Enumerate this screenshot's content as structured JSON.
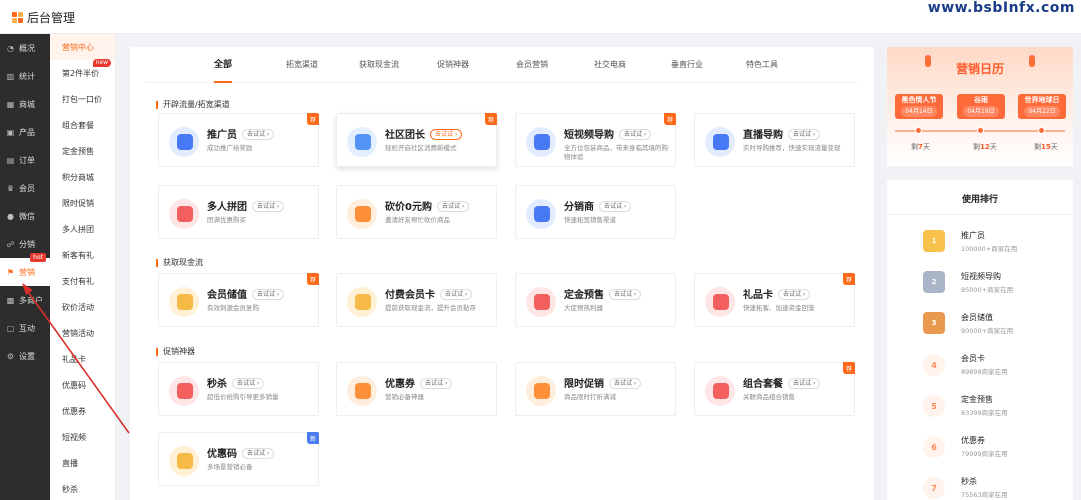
{
  "header": {
    "title": "后台管理",
    "watermark": "www.bsbInfx.com"
  },
  "nav_primary": [
    {
      "label": "概况",
      "icon": "gauge-icon"
    },
    {
      "label": "统计",
      "icon": "chart-icon"
    },
    {
      "label": "商城",
      "icon": "store-icon"
    },
    {
      "label": "产品",
      "icon": "grid-icon"
    },
    {
      "label": "订单",
      "icon": "order-icon"
    },
    {
      "label": "会员",
      "icon": "crown-icon"
    },
    {
      "label": "微信",
      "icon": "wechat-icon"
    },
    {
      "label": "分销",
      "icon": "share-icon"
    },
    {
      "label": "营销",
      "icon": "flag-icon",
      "badge": "hot",
      "active": true
    },
    {
      "label": "多商户",
      "icon": "shop-icon"
    },
    {
      "label": "互动",
      "icon": "chat-icon"
    },
    {
      "label": "设置",
      "icon": "gear-icon"
    }
  ],
  "nav_secondary": [
    {
      "label": "营销中心",
      "active": true
    },
    {
      "label": "第2件半价",
      "badge": "new"
    },
    {
      "label": "打包一口价"
    },
    {
      "label": "组合套餐"
    },
    {
      "label": "定金预售"
    },
    {
      "label": "积分商城"
    },
    {
      "label": "限时促销"
    },
    {
      "label": "多人拼团"
    },
    {
      "label": "新客有礼"
    },
    {
      "label": "支付有礼"
    },
    {
      "label": "砍价活动"
    },
    {
      "label": "营销活动"
    },
    {
      "label": "礼品卡"
    },
    {
      "label": "优惠码"
    },
    {
      "label": "优惠券"
    },
    {
      "label": "短视频"
    },
    {
      "label": "直播"
    },
    {
      "label": "秒杀"
    }
  ],
  "tabs": [
    "全部",
    "拓宽渠道",
    "获取现金流",
    "促销神器",
    "会员营销",
    "社交电商",
    "垂直行业",
    "特色工具"
  ],
  "try_label": "去试试",
  "sections": [
    {
      "title": "开辟流量/拓宽渠道"
    },
    {
      "title": "获取现金流"
    },
    {
      "title": "促销神器"
    }
  ],
  "cards": [
    {
      "title": "推广员",
      "desc": "成功推广给奖励",
      "rec": "荐",
      "icon": "megaphone-icon",
      "color": "blue"
    },
    {
      "title": "社区团长",
      "desc": "轻松开启社区消费新模式",
      "rec": "荐",
      "icon": "leader-icon",
      "color": "cyan"
    },
    {
      "title": "短视频导购",
      "desc": "全方位包装商品，带来身临其境的购物体验",
      "rec": "荐",
      "icon": "video-icon",
      "color": "blue"
    },
    {
      "title": "直播导购",
      "desc": "实时导购推荐，快速实现流量变现",
      "rec": "",
      "icon": "live-icon",
      "color": "blue"
    },
    {
      "title": "多人拼团",
      "desc": "团满优惠购买",
      "rec": "",
      "icon": "group-icon",
      "color": "red"
    },
    {
      "title": "砍价0元购",
      "desc": "邀请好友帮忙砍价商品",
      "rec": "",
      "icon": "tag-icon",
      "color": "orange"
    },
    {
      "title": "分销商",
      "desc": "快速拓宽销售渠道",
      "rec": "",
      "icon": "distributor-icon",
      "color": "blue"
    },
    {
      "title": "会员储值",
      "desc": "有效刺激会员复购",
      "rec": "荐",
      "icon": "coin-icon",
      "color": "yellow"
    },
    {
      "title": "付费会员卡",
      "desc": "提前获取现金流，提升会员黏存",
      "rec": "",
      "icon": "vip-icon",
      "color": "yellow"
    },
    {
      "title": "定金预售",
      "desc": "大促预热利器",
      "rec": "",
      "icon": "deposit-icon",
      "color": "red"
    },
    {
      "title": "礼品卡",
      "desc": "快速拓客、加速资金回笼",
      "rec": "荐",
      "icon": "gift-icon",
      "color": "red"
    },
    {
      "title": "秒杀",
      "desc": "超低价抢购引导更多销量",
      "rec": "",
      "icon": "flash-icon",
      "color": "red"
    },
    {
      "title": "优惠券",
      "desc": "营销必备神器",
      "rec": "",
      "icon": "coupon-icon",
      "color": "orange"
    },
    {
      "title": "限时促销",
      "desc": "商品限时打折满减",
      "rec": "",
      "icon": "discount-icon",
      "color": "orange"
    },
    {
      "title": "组合套餐",
      "desc": "关联商品组合销售",
      "rec": "荐",
      "icon": "package-icon",
      "color": "red"
    },
    {
      "title": "优惠码",
      "desc": "多场景营销必备",
      "rec": "新",
      "icon": "code-icon",
      "color": "yellow"
    }
  ],
  "calendar": {
    "title": "营销日历",
    "events": [
      {
        "name": "黑色情人节",
        "date": "04月14日",
        "pre": "剩",
        "days": "7",
        "unit": "天"
      },
      {
        "name": "谷雨",
        "date": "04月19日",
        "pre": "剩",
        "days": "12",
        "unit": "天"
      },
      {
        "name": "世界地球日",
        "date": "04月22日",
        "pre": "剩",
        "days": "15",
        "unit": "天"
      }
    ]
  },
  "ranking": {
    "title": "使用排行",
    "items": [
      {
        "rank": "1",
        "name": "推广员",
        "count": "100000+商家在用"
      },
      {
        "rank": "2",
        "name": "短视频导购",
        "count": "95000+商家在用"
      },
      {
        "rank": "3",
        "name": "会员储值",
        "count": "90000+商家在用"
      },
      {
        "rank": "4",
        "name": "会员卡",
        "count": "89898商家在用"
      },
      {
        "rank": "5",
        "name": "定金预售",
        "count": "83399商家在用"
      },
      {
        "rank": "6",
        "name": "优惠券",
        "count": "79999商家在用"
      },
      {
        "rank": "7",
        "name": "秒杀",
        "count": "75563商家在用"
      }
    ]
  }
}
